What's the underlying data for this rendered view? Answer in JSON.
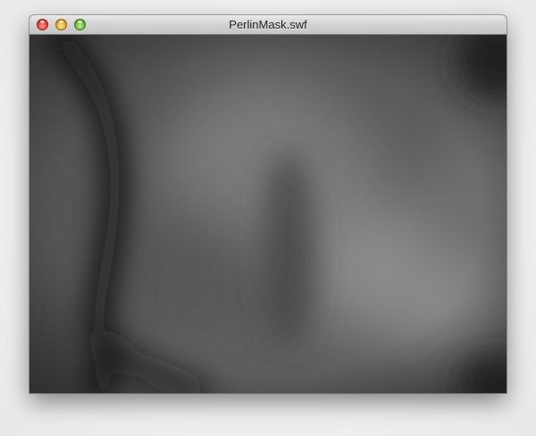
{
  "window": {
    "title": "PerlinMask.swf"
  },
  "title_buttons": {
    "close": "close-button",
    "minimize": "minimize-button",
    "zoom": "zoom-button"
  },
  "colors": {
    "close": "#e1412f",
    "minimize": "#e9a722",
    "zoom": "#69b631"
  }
}
